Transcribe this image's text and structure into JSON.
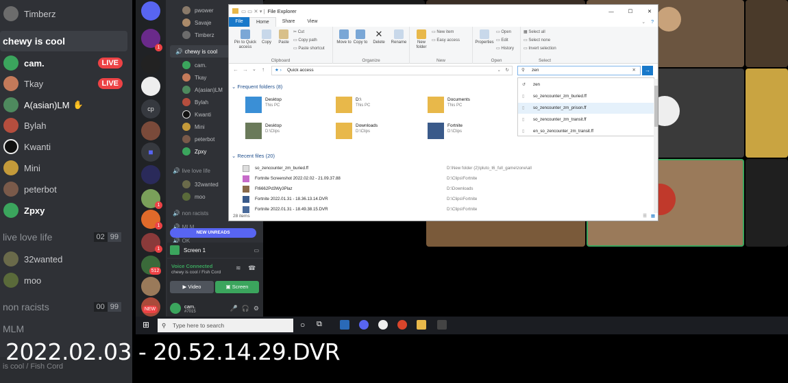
{
  "left_panel": {
    "members_top": [
      {
        "name": "Timberz"
      }
    ],
    "channel_chewy": "chewy is cool",
    "members": [
      {
        "name": "cam.",
        "live": "LIVE",
        "color": "#3ba55d"
      },
      {
        "name": "Tkay",
        "live": "LIVE",
        "color": "#c47a5a"
      },
      {
        "name": "A(asian)LM",
        "color": "#4e8a5e"
      },
      {
        "name": "Bylah",
        "color": "#b54e3e"
      },
      {
        "name": "Kwanti",
        "color": "#111111"
      },
      {
        "name": "Mini",
        "color": "#c49a3a"
      },
      {
        "name": "peterbot",
        "color": "#7a5a4a"
      },
      {
        "name": "Zpxy",
        "color": "#3ba55d"
      }
    ],
    "channel_live": "live love life",
    "channel_live_counts": [
      "02",
      "99"
    ],
    "live_members": [
      {
        "name": "32wanted",
        "color": "#6a6a4a"
      },
      {
        "name": "moo",
        "color": "#5a6a3a"
      }
    ],
    "channel_nonracists": "non racists",
    "channel_nonracists_counts": [
      "00",
      "99"
    ],
    "channel_mlm": "MLM",
    "bottom_text": "is cool / Fish Cord"
  },
  "mid_panel": {
    "top_members": [
      "pwower",
      "Savaje",
      "Timberz"
    ],
    "channel_chewy": "chewy is cool",
    "members": [
      "cam.",
      "Tkay",
      "A(asian)LM",
      "Bylah",
      "Kwanti",
      "Mini",
      "peterbot",
      "Zpxy"
    ],
    "channel_live": "live love life",
    "live_members": [
      "32wanted",
      "moo"
    ],
    "channel_nonracists": "non racists",
    "channel_mlm": "MLM",
    "channel_ok": "OK",
    "new_unreads": "NEW UNREADS",
    "screen_label": "Screen 1",
    "voice_connected": "Voice Connected",
    "voice_channel": "chewy is cool / Fish Cord",
    "video_btn": "Video",
    "screen_btn": "Screen",
    "user_name": "cam.",
    "user_tag": "#7015",
    "guild_icon_text": "cp",
    "badges": [
      "1",
      "1",
      "1",
      "512",
      "NEW",
      "1"
    ]
  },
  "explorer": {
    "title": "File Explorer",
    "tabs": {
      "file": "File",
      "home": "Home",
      "share": "Share",
      "view": "View"
    },
    "ribbon": {
      "pin": "Pin to Quick access",
      "copy": "Copy",
      "paste": "Paste",
      "cut": "Cut",
      "copy_path": "Copy path",
      "paste_shortcut": "Paste shortcut",
      "clipboard": "Clipboard",
      "move_to": "Move to",
      "copy_to": "Copy to",
      "delete": "Delete",
      "rename": "Rename",
      "organize": "Organize",
      "new_folder": "New folder",
      "new_item": "New item",
      "easy_access": "Easy access",
      "new": "New",
      "properties": "Properties",
      "open": "Open",
      "edit": "Edit",
      "history": "History",
      "open_group": "Open",
      "select_all": "Select all",
      "select_none": "Select none",
      "invert_selection": "Invert selection",
      "select": "Select"
    },
    "address": "Quick access",
    "search_value": "zen",
    "frequent_header": "Frequent folders (8)",
    "frequent": [
      {
        "name": "Desktop",
        "sub": "This PC",
        "color": "#3a8fd6"
      },
      {
        "name": "D:\\",
        "sub": "This PC",
        "color": "#e8b84a"
      },
      {
        "name": "Documents",
        "sub": "This PC",
        "color": "#e8b84a"
      },
      {
        "name": "Desktop",
        "sub": "D:\\Clips",
        "color": "#6a7a5a"
      },
      {
        "name": "Downloads",
        "sub": "D:\\Clips",
        "color": "#e8b84a"
      },
      {
        "name": "Fortnite",
        "sub": "D:\\Clips",
        "color": "#3a5a8a"
      }
    ],
    "recent_header": "Recent files (20)",
    "recent": [
      {
        "name": "so_zencounter_zm_buried.ff",
        "path": "D:\\New folder (2)\\pluto_t6_full_game\\zone\\all",
        "color": "#dddddd"
      },
      {
        "name": "Fortnite Screenshot 2022.02.02 - 21.09.37.88",
        "path": "D:\\Clips\\Fortnite",
        "color": "#c76ac9"
      },
      {
        "name": "Ft6662Pd3Wy3Plaz",
        "path": "D:\\Downloads",
        "color": "#8a6a4a"
      },
      {
        "name": "Fortnite 2022.01.31 - 18.36.13.14.DVR",
        "path": "D:\\Clips\\Fortnite",
        "color": "#3a5a8a"
      },
      {
        "name": "Fortnite 2022.01.31 - 18.49.38.15.DVR",
        "path": "D:\\Clips\\Fortnite",
        "color": "#4a6a9a"
      }
    ],
    "item_count": "28 items",
    "suggestions": [
      {
        "text": "zen"
      },
      {
        "text": "so_zencounter_zm_buried.ff"
      },
      {
        "text": "so_zencounter_zm_prison.ff"
      },
      {
        "text": "so_zencounter_zm_transit.ff"
      },
      {
        "text": "en_so_zencounter_zm_transit.ff"
      }
    ]
  },
  "taskbar": {
    "search_placeholder": "Type here to search"
  },
  "caption": "2022.02.03 - 20.52.14.29.DVR",
  "colors": {
    "discord_bg": "#2f3136",
    "discord_dark": "#202225",
    "live_red": "#ed4245",
    "voice_green": "#3ba55d",
    "explorer_blue": "#1979ca"
  }
}
